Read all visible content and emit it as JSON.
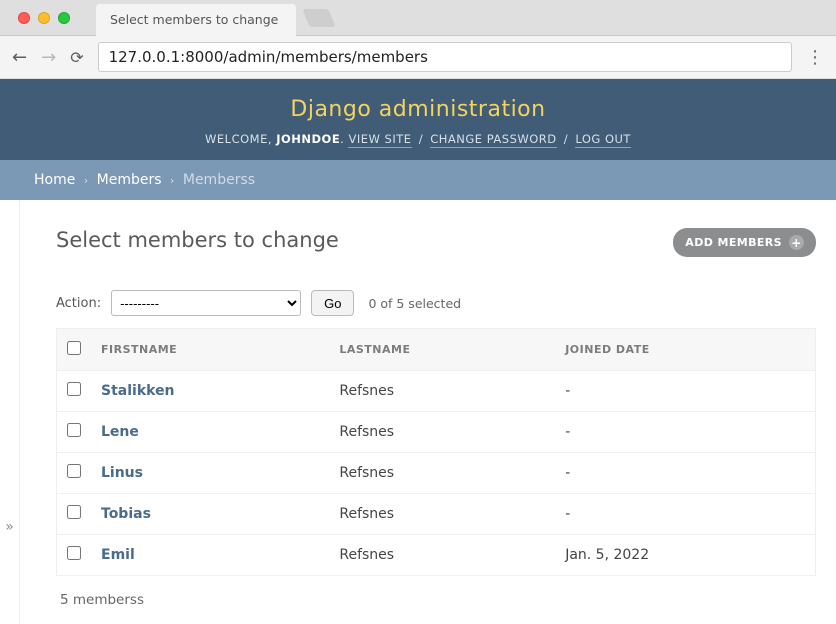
{
  "browser": {
    "tab_title": "Select members to change",
    "url": "127.0.0.1:8000/admin/members/members"
  },
  "header": {
    "site_title": "Django administration",
    "welcome_label": "WELCOME,",
    "username": "JOHNDOE",
    "view_site": "VIEW SITE",
    "change_password": "CHANGE PASSWORD",
    "logout": "LOG OUT"
  },
  "breadcrumbs": {
    "home": "Home",
    "app": "Members",
    "model": "Memberss"
  },
  "page": {
    "title": "Select members to change",
    "add_button": "ADD MEMBERS"
  },
  "actions": {
    "label": "Action:",
    "placeholder": "---------",
    "go": "Go",
    "counter": "0 of 5 selected"
  },
  "table": {
    "headers": {
      "firstname": "FIRSTNAME",
      "lastname": "LASTNAME",
      "joined": "JOINED DATE"
    },
    "rows": [
      {
        "firstname": "Stalikken",
        "lastname": "Refsnes",
        "joined": "-"
      },
      {
        "firstname": "Lene",
        "lastname": "Refsnes",
        "joined": "-"
      },
      {
        "firstname": "Linus",
        "lastname": "Refsnes",
        "joined": "-"
      },
      {
        "firstname": "Tobias",
        "lastname": "Refsnes",
        "joined": "-"
      },
      {
        "firstname": "Emil",
        "lastname": "Refsnes",
        "joined": "Jan. 5, 2022"
      }
    ]
  },
  "paginator": "5 memberss"
}
